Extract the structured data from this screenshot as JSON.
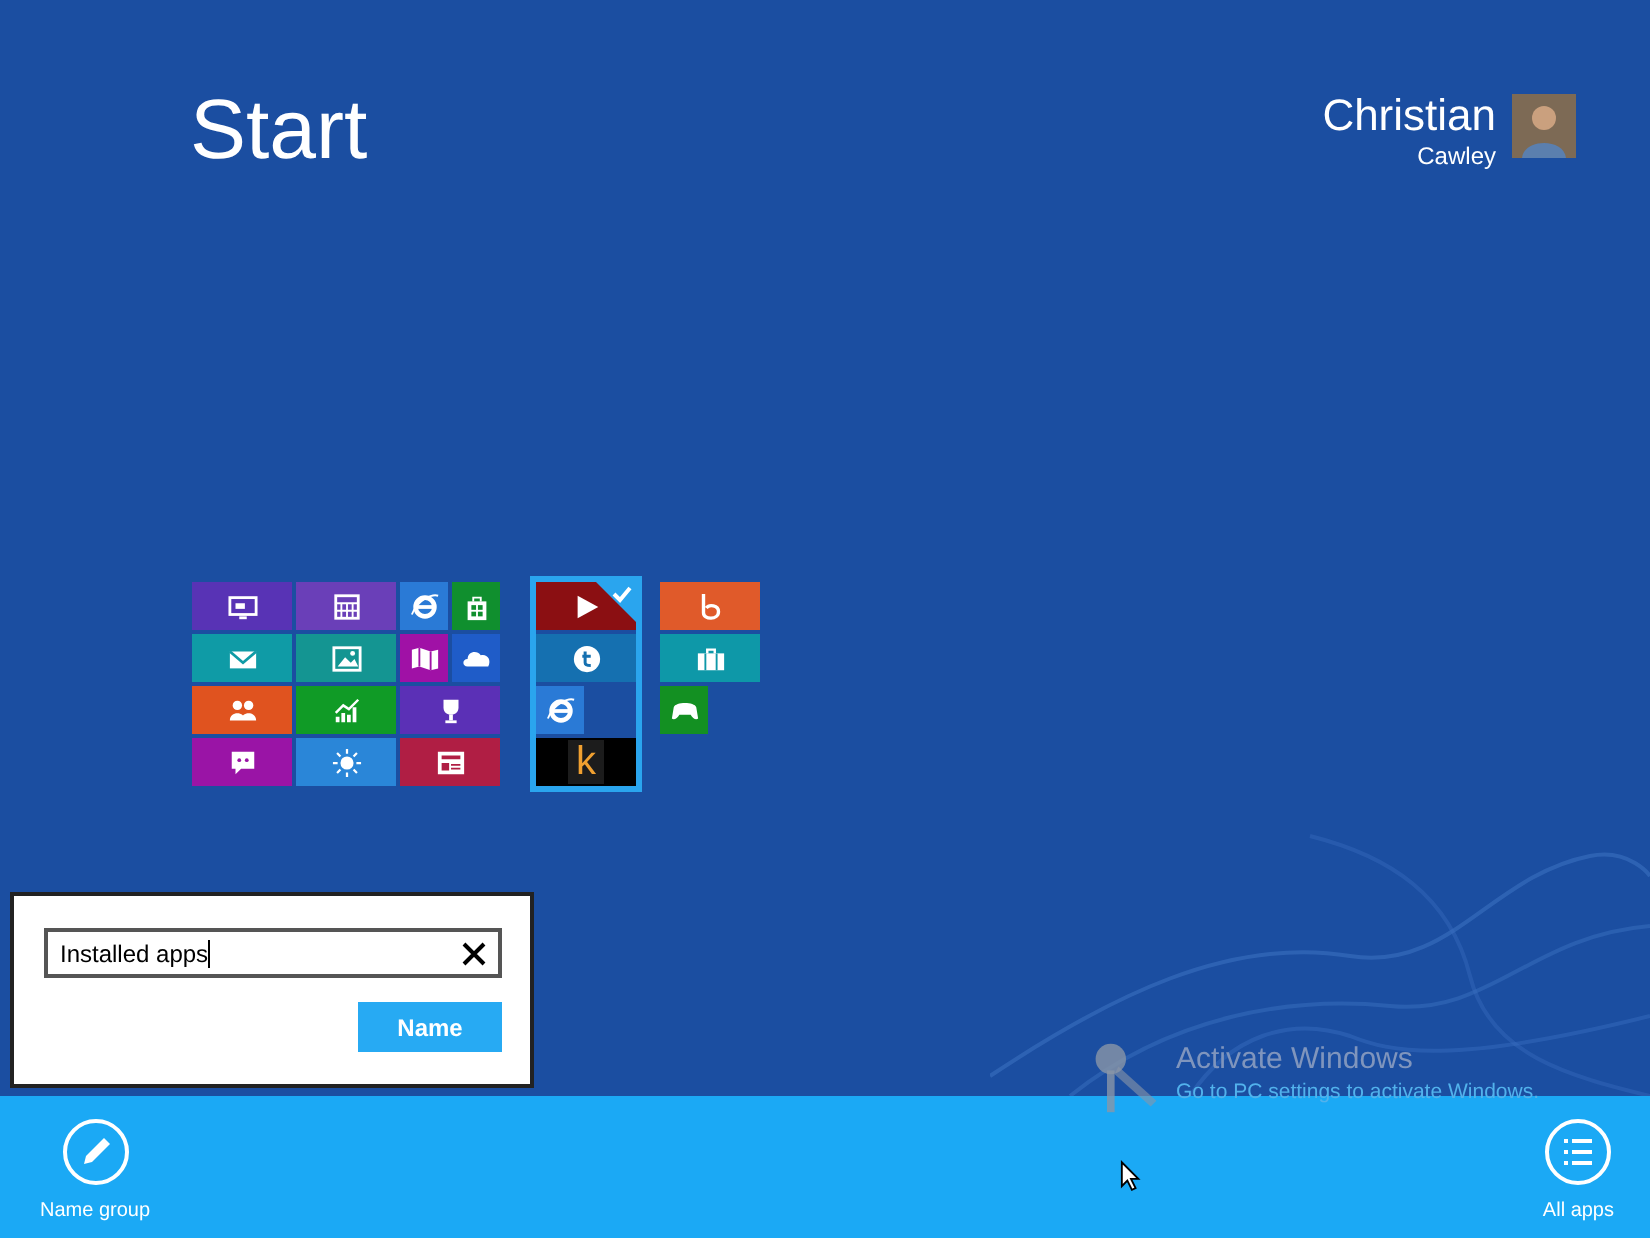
{
  "start": {
    "title": "Start"
  },
  "user": {
    "first_name": "Christian",
    "last_name": "Cawley"
  },
  "groups": [
    {
      "selected": false,
      "tiles": [
        {
          "kind": "wide",
          "color": "#5833b5",
          "selected": false
        },
        {
          "kind": "wide",
          "color": "#6a3fb8",
          "selected": false
        },
        {
          "kind": "small",
          "color": "#2a7ad6",
          "selected": false
        },
        {
          "kind": "small",
          "color": "#108f2e",
          "selected": false
        },
        {
          "kind": "wide",
          "color": "#0f9ba6",
          "selected": false
        },
        {
          "kind": "wide",
          "color": "#149592",
          "selected": false
        },
        {
          "kind": "small",
          "color": "#a011a6",
          "selected": false
        },
        {
          "kind": "small",
          "color": "#1f5cc8",
          "selected": false
        },
        {
          "kind": "wide",
          "color": "#e0531f",
          "selected": false
        },
        {
          "kind": "wide",
          "color": "#109b26",
          "selected": false
        },
        {
          "kind": "wide",
          "color": "#5b30b6",
          "selected": false
        },
        {
          "kind": "wide",
          "color": "#9a14a6",
          "selected": false
        },
        {
          "kind": "wide",
          "color": "#2a86d8",
          "selected": false
        },
        {
          "kind": "wide",
          "color": "#b01e44",
          "selected": false
        }
      ]
    },
    {
      "selected": true,
      "tiles": [
        {
          "kind": "wide",
          "color": "#8b0f12",
          "selected": true
        },
        {
          "kind": "wide",
          "color": "#1570b0",
          "selected": false
        },
        {
          "kind": "small",
          "color": "#2a7ad6",
          "selected": false
        },
        {
          "kind": "wide",
          "color": "#000000",
          "selected": false,
          "label": "k"
        }
      ]
    },
    {
      "selected": false,
      "tiles": [
        {
          "kind": "wide",
          "color": "#e05a2a",
          "selected": false
        },
        {
          "kind": "wide",
          "color": "#0e98a8",
          "selected": false
        },
        {
          "kind": "small",
          "color": "#139022",
          "selected": false
        }
      ]
    }
  ],
  "name_dialog": {
    "value": "Installed apps",
    "button": "Name"
  },
  "activation_notice": {
    "title": "Activate Windows",
    "text": "Go to PC settings to activate Windows."
  },
  "app_bar": {
    "buttons": [
      {
        "label": "Name group"
      },
      {
        "label": "All apps"
      }
    ]
  }
}
